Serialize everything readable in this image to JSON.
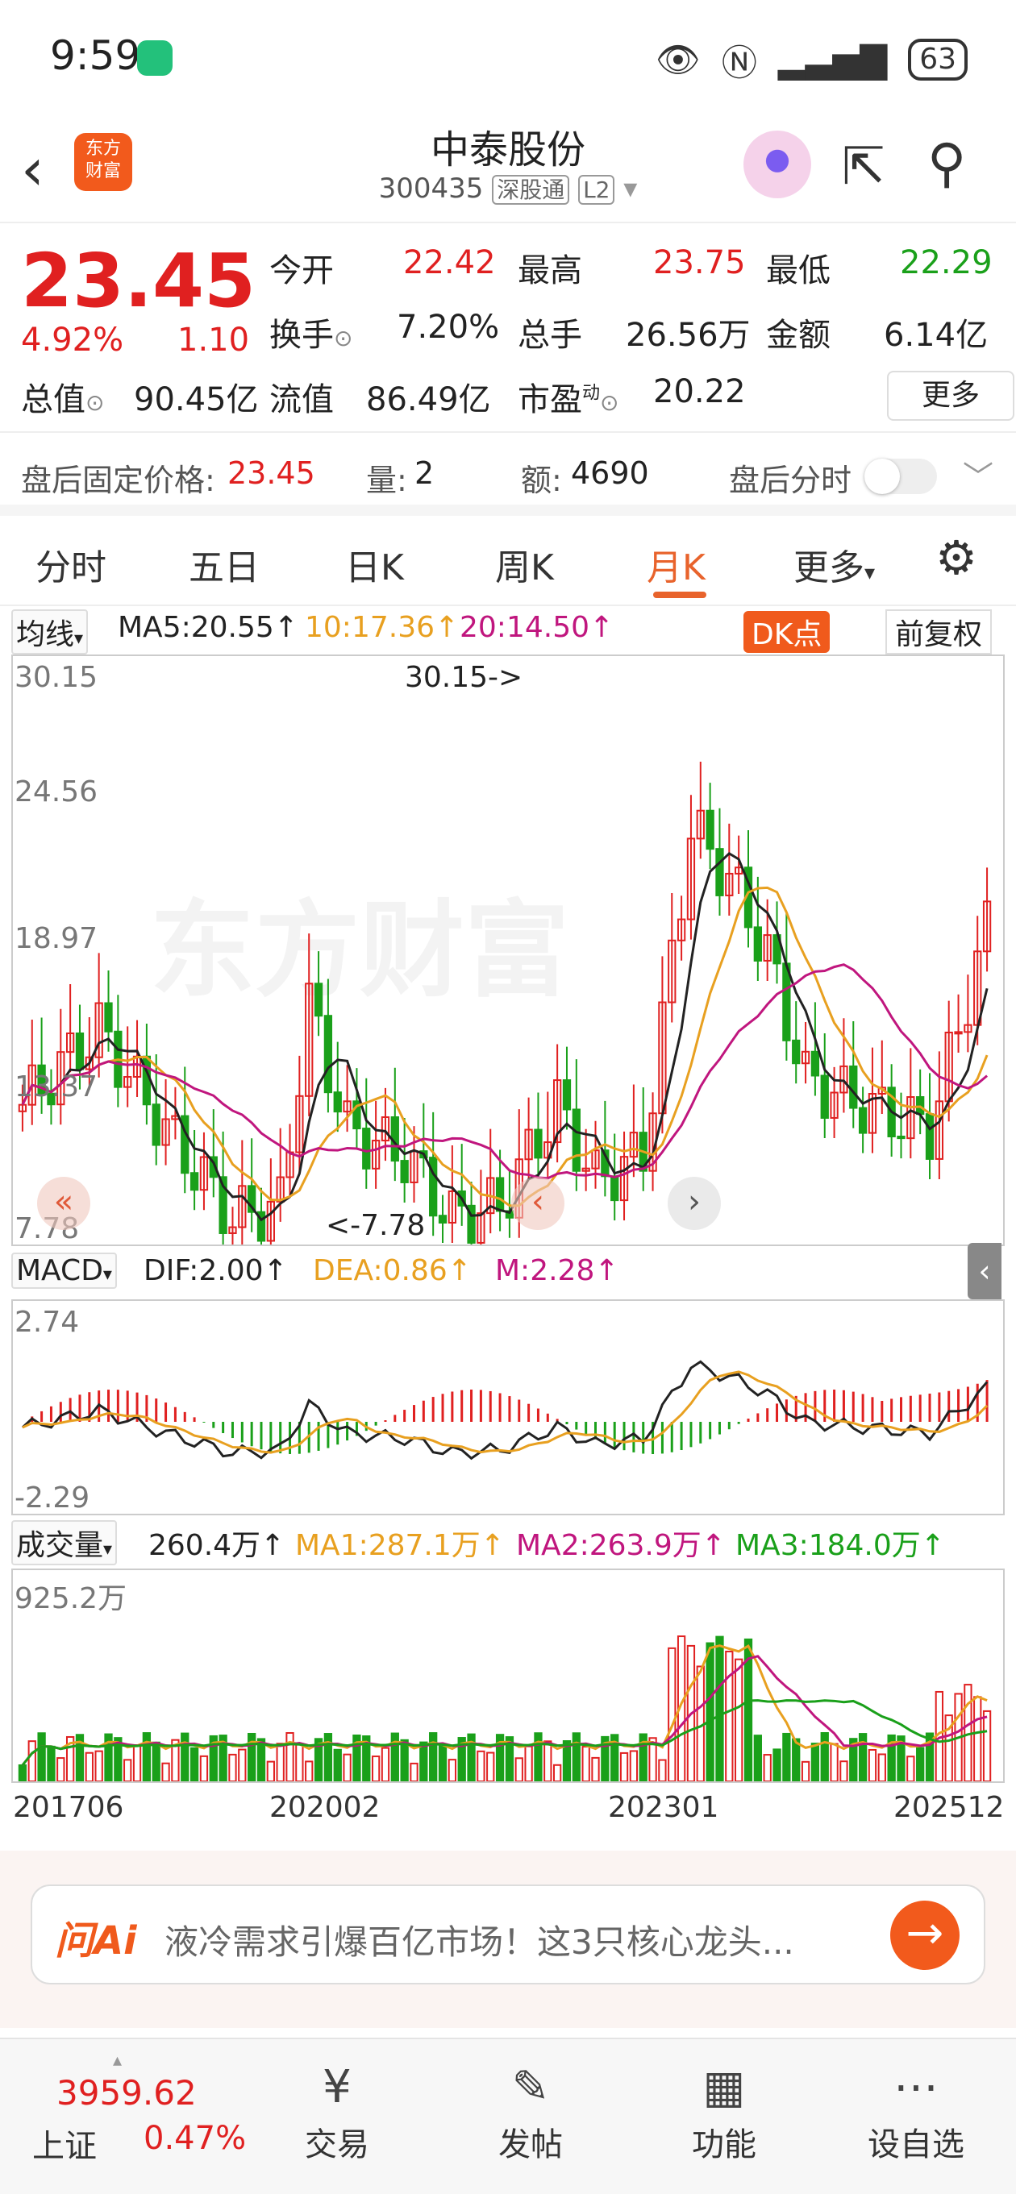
{
  "status": {
    "time": "9:59",
    "battery": "63"
  },
  "header": {
    "name": "中泰股份",
    "code": "300435",
    "market_tag": "深股通",
    "level_tag": "L2",
    "logo_line1": "东方",
    "logo_line2": "财富"
  },
  "quote": {
    "price": "23.45",
    "change_pct": "4.92%",
    "change": "1.10",
    "open_label": "今开",
    "open": "22.42",
    "high_label": "最高",
    "high": "23.75",
    "low_label": "最低",
    "low": "22.29",
    "turnover_label": "换手",
    "turnover": "7.20%",
    "volume_label": "总手",
    "volume": "26.56万",
    "amount_label": "金额",
    "amount": "6.14亿",
    "mcap_label": "总值",
    "mcap": "90.45亿",
    "float_label": "流值",
    "float": "86.49亿",
    "pe_label": "市盈",
    "pe_sup": "动",
    "pe": "20.22",
    "more": "更多"
  },
  "after_hours": {
    "label": "盘后固定价格:",
    "price": "23.45",
    "vol_label": "量:",
    "vol": "2",
    "amt_label": "额:",
    "amt": "4690",
    "toggle_label": "盘后分时"
  },
  "tabs": [
    "分时",
    "五日",
    "日K",
    "周K",
    "月K",
    "更多"
  ],
  "active_tab": "月K",
  "ma": {
    "selector": "均线",
    "ma5": "MA5:20.55↑",
    "ma10": "10:17.36↑",
    "ma20": "20:14.50↑",
    "dk": "DK点",
    "adjust": "前复权",
    "ma5_color": "#222222",
    "ma10_color": "#e8a020",
    "ma20_color": "#c0167e"
  },
  "kline": {
    "y_top": "30.15",
    "y_2": "24.56",
    "y_3": "18.97",
    "y_4": "13.37",
    "y_bottom": "7.78",
    "max_note": "30.15->",
    "min_note": "<-7.78"
  },
  "macd": {
    "selector": "MACD",
    "dif": "DIF:2.00↑",
    "dea": "DEA:0.86↑",
    "m": "M:2.28↑",
    "y_top": "2.74",
    "y_bottom": "-2.29"
  },
  "vol": {
    "selector": "成交量",
    "val": "260.4万↑",
    "ma1": "MA1:287.1万↑",
    "ma2": "MA2:263.9万↑",
    "ma3": "MA3:184.0万↑",
    "y_top": "925.2万"
  },
  "dates": [
    "201706",
    "202002",
    "202301",
    "202512"
  ],
  "ai": {
    "logo": "问Ai",
    "text": "液冷需求引爆百亿市场！这3只核心龙头..."
  },
  "bottom": {
    "index_value": "3959.62",
    "index_name": "上证",
    "index_pct": "0.47%",
    "items": [
      "交易",
      "发帖",
      "功能",
      "设自选"
    ]
  },
  "colors": {
    "up": "#e02020",
    "down": "#1aa01a",
    "accent": "#e8632c"
  }
}
